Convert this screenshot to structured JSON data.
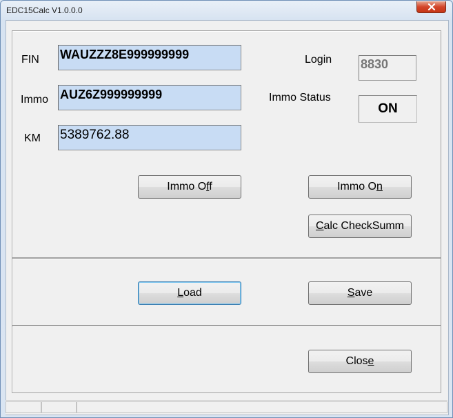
{
  "window": {
    "title": "EDC15Calc V1.0.0.0"
  },
  "fields": {
    "fin": {
      "label": "FIN",
      "value": "WAUZZZ8E999999999"
    },
    "immo": {
      "label": "Immo",
      "value": "AUZ6Z999999999"
    },
    "km": {
      "label": "KM",
      "value": "5389762.88"
    },
    "login": {
      "label": "Login",
      "value": "8830"
    },
    "immo_status": {
      "label": "Immo Status",
      "value": "ON"
    }
  },
  "buttons": {
    "immo_off": {
      "pre": "Immo O",
      "mn": "f",
      "post": "f"
    },
    "immo_on": {
      "pre": "Immo O",
      "mn": "n",
      "post": ""
    },
    "calc": {
      "pre": "",
      "mn": "C",
      "post": "alc CheckSumm"
    },
    "load": {
      "pre": "",
      "mn": "L",
      "post": "oad"
    },
    "save": {
      "pre": "",
      "mn": "S",
      "post": "ave"
    },
    "close": {
      "pre": "Clos",
      "mn": "e",
      "post": ""
    }
  },
  "icons": {
    "close": "close-x-icon"
  },
  "colors": {
    "field_bg": "#c8dcf4",
    "close_red": "#c63515",
    "default_border": "#3c7fb1"
  }
}
